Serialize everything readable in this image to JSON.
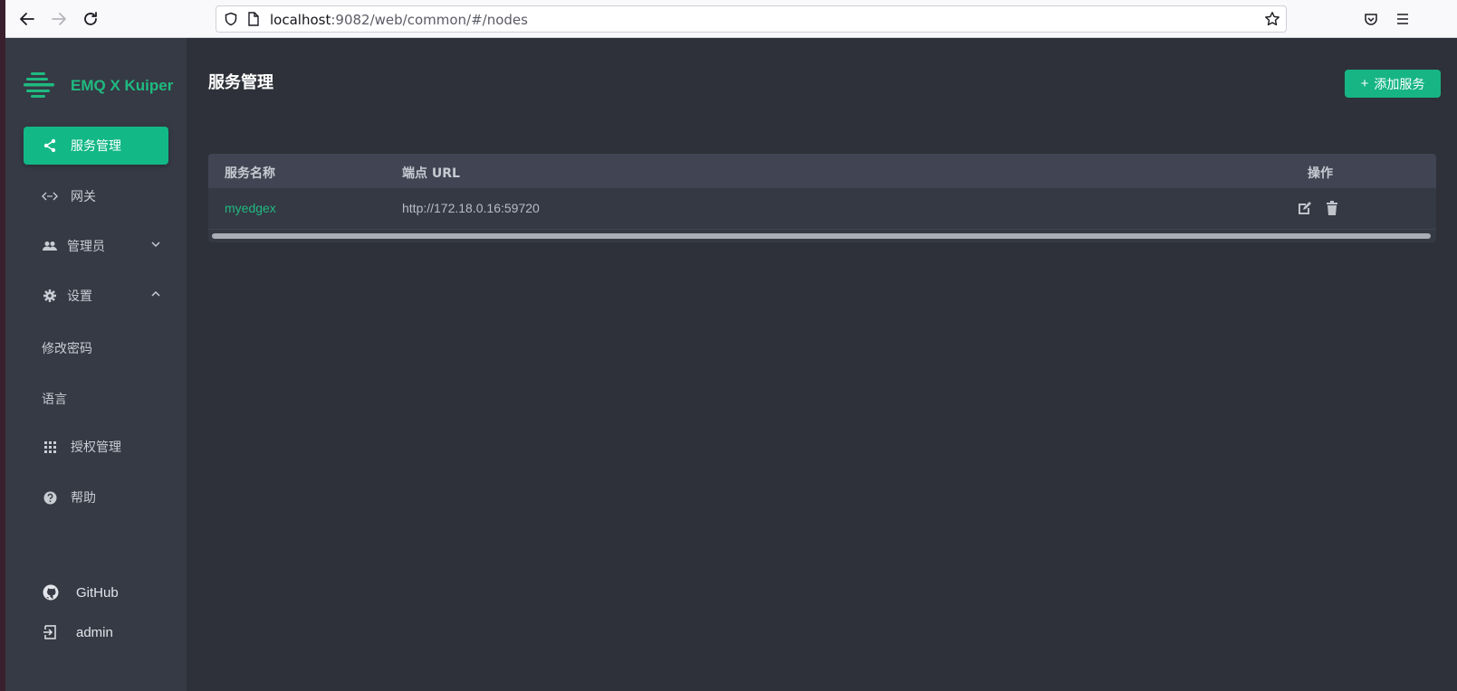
{
  "browser": {
    "url_host": "localhost",
    "url_rest": ":9082/web/common/#/nodes"
  },
  "sidebar": {
    "logo_text": "EMQ X Kuiper",
    "items": [
      {
        "label": "服务管理",
        "icon": "share-icon",
        "active": true
      },
      {
        "label": "网关",
        "icon": "code-arrows-icon"
      },
      {
        "label": "管理员",
        "icon": "users-icon",
        "expand": "chevron-down-icon"
      },
      {
        "label": "设置",
        "icon": "gear-icon",
        "expand": "chevron-up-icon"
      }
    ],
    "settings_sub": [
      "修改密码",
      "语言"
    ],
    "extra_items": [
      {
        "label": "授权管理",
        "icon": "grid-icon"
      },
      {
        "label": "帮助",
        "icon": "help-icon"
      }
    ],
    "bottom": {
      "github_label": "GitHub",
      "user_label": "admin"
    }
  },
  "main": {
    "title": "服务管理",
    "add_button": "添加服务",
    "table": {
      "headers": [
        "服务名称",
        "端点 URL",
        "操作"
      ],
      "rows": [
        {
          "name": "myedgex",
          "url": "http://172.18.0.16:59720"
        }
      ]
    }
  },
  "colors": {
    "accent": "#12b886",
    "sidebar_bg": "#363a45",
    "main_bg": "#2e3139"
  }
}
